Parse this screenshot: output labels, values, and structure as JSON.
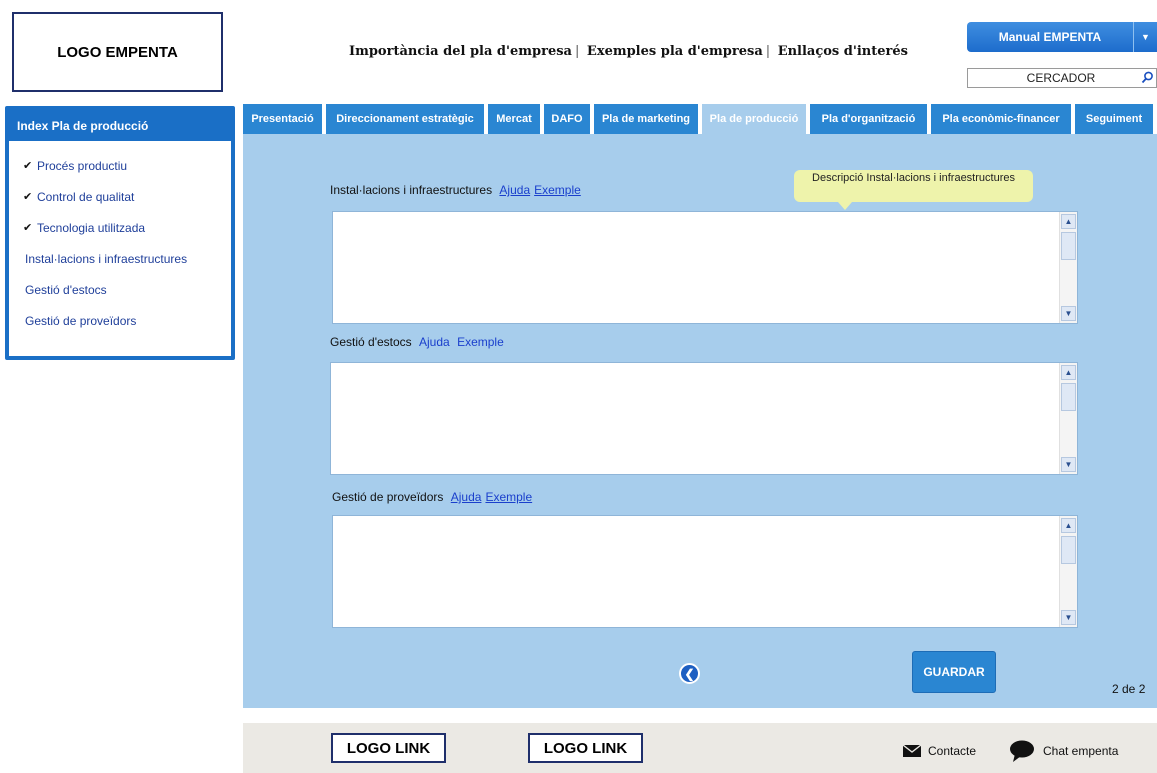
{
  "header": {
    "logo_text": "LOGO EMPENTA",
    "nav": [
      "Importància del pla d'empresa",
      "Exemples pla d'empresa",
      "Enllaços d'interés"
    ],
    "manual_button": "Manual EMPENTA",
    "search_placeholder": "CERCADOR"
  },
  "sidebar": {
    "title": "Index Pla de producció",
    "items": [
      {
        "label": "Procés productiu",
        "checked": true
      },
      {
        "label": "Control de qualitat",
        "checked": true
      },
      {
        "label": "Tecnologia utilitzada",
        "checked": true
      },
      {
        "label": "Instal·lacions i infraestructures",
        "checked": false
      },
      {
        "label": "Gestió d'estocs",
        "checked": false
      },
      {
        "label": "Gestió de proveïdors",
        "checked": false
      }
    ]
  },
  "tabs": [
    "Presentació",
    "Direccionament estratègic",
    "Mercat",
    "DAFO",
    "Pla de marketing",
    "Pla de producció",
    "Pla d'organització",
    "Pla econòmic-financer",
    "Seguiment"
  ],
  "active_tab": "Pla de producció",
  "form": {
    "fields": [
      {
        "label": "Instal·lacions i infraestructures",
        "help": "Ajuda",
        "example": "Exemple",
        "value": ""
      },
      {
        "label": "Gestió d'estocs",
        "help": "Ajuda",
        "example": "Exemple",
        "value": ""
      },
      {
        "label": "Gestió de proveïdors",
        "help": "Ajuda",
        "example": "Exemple",
        "value": ""
      }
    ],
    "tooltip": "Descripció Instal·lacions i infraestructures",
    "save_button": "GUARDAR",
    "page_indicator": "2 de 2"
  },
  "footer": {
    "logo_links": [
      "LOGO LINK",
      "LOGO LINK"
    ],
    "contact": "Contacte",
    "chat": "Chat empenta"
  },
  "colors": {
    "accent": "#2a86d2",
    "panel": "#a7cdec",
    "tooltip": "#eef3ab",
    "border_dark": "#1f2f6b"
  }
}
